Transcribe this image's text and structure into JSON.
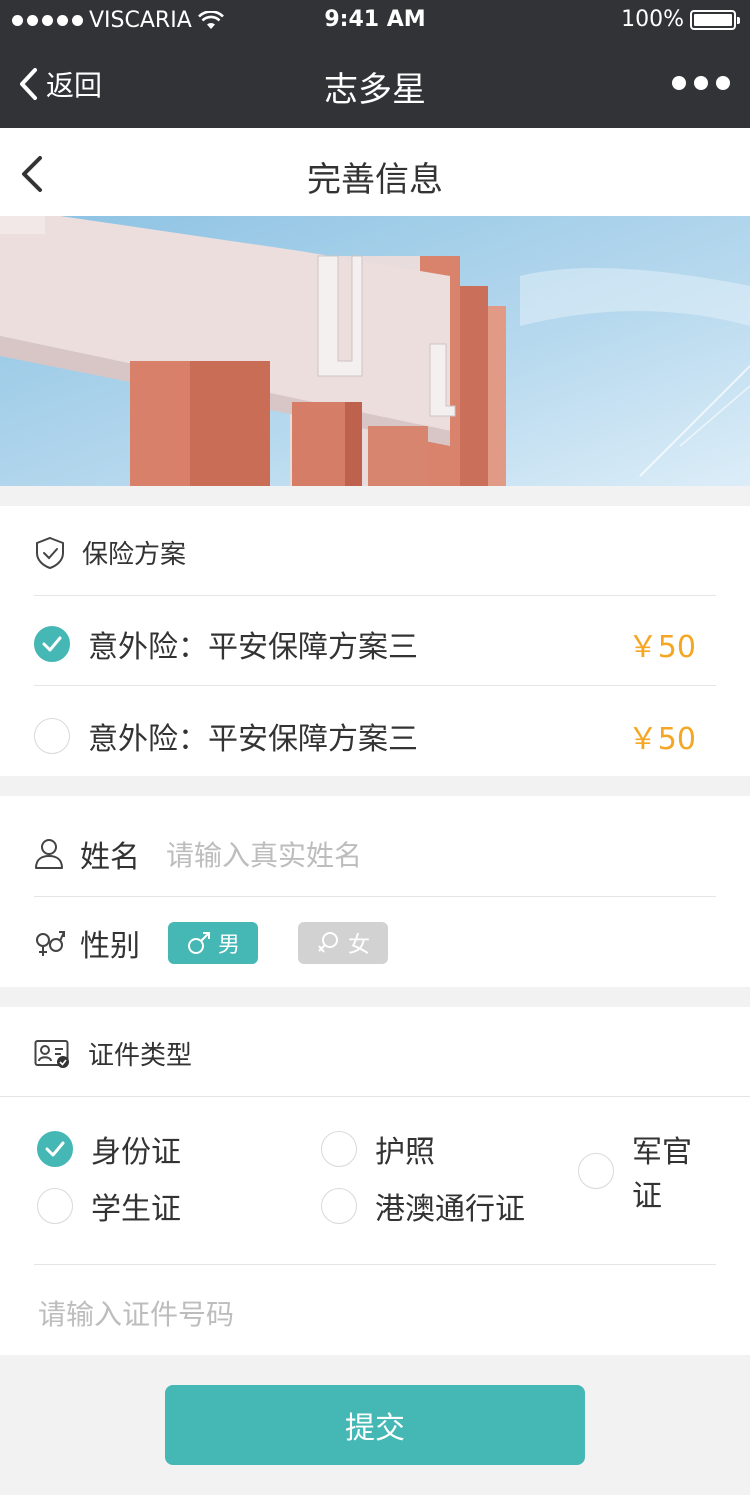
{
  "status_bar": {
    "carrier": "VISCARIA",
    "time": "9:41 AM",
    "battery": "100%"
  },
  "nav": {
    "back_label": "返回",
    "title": "志多星"
  },
  "page": {
    "title": "完善信息"
  },
  "insurance": {
    "header": "保险方案",
    "options": [
      {
        "label": "意外险：平安保障方案三",
        "price": "￥50",
        "selected": true
      },
      {
        "label": "意外险：平安保障方案三",
        "price": "￥50",
        "selected": false
      }
    ]
  },
  "profile": {
    "name_label": "姓名",
    "name_placeholder": "请输入真实姓名",
    "gender_label": "性别",
    "gender_male": "男",
    "gender_female": "女"
  },
  "id": {
    "header": "证件类型",
    "types": [
      {
        "label": "身份证",
        "selected": true
      },
      {
        "label": "护照",
        "selected": false
      },
      {
        "label": "军官证",
        "selected": false
      },
      {
        "label": "学生证",
        "selected": false
      },
      {
        "label": "港澳通行证",
        "selected": false
      }
    ],
    "number_placeholder": "请输入证件号码"
  },
  "submit_label": "提交",
  "colors": {
    "accent": "#45b7b4",
    "price": "#f5a623",
    "nav_bg": "#323337"
  }
}
